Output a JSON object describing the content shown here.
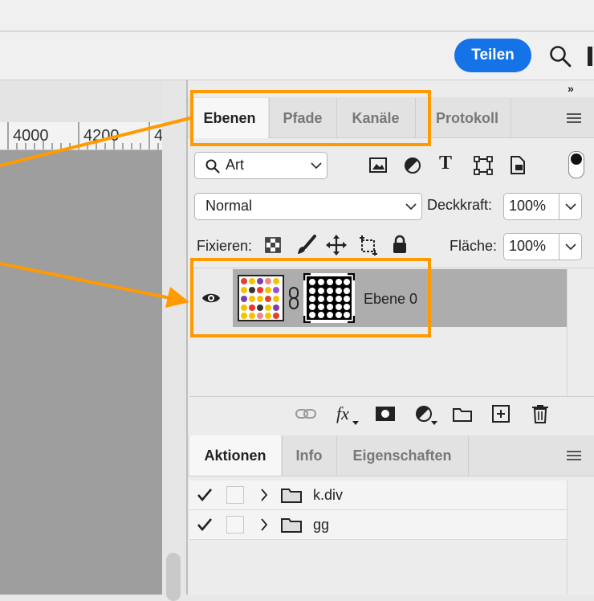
{
  "topbar": {
    "share_label": "Teilen"
  },
  "ruler": {
    "ticks": [
      "4000",
      "4200",
      "4"
    ]
  },
  "panel": {
    "tabs": [
      {
        "label": "Ebenen",
        "active": true
      },
      {
        "label": "Pfade",
        "active": false
      },
      {
        "label": "Kanäle",
        "active": false
      },
      {
        "label": "Protokoll",
        "active": false
      }
    ],
    "filter": {
      "value": "Art"
    },
    "blend_mode": {
      "value": "Normal"
    },
    "opacity": {
      "label": "Deckkraft:",
      "value": "100%"
    },
    "lock": {
      "label": "Fixieren:"
    },
    "fill": {
      "label": "Fläche:",
      "value": "100%"
    },
    "layer": {
      "name": "Ebene 0"
    },
    "bottom_icons": [
      "link-icon",
      "fx-icon",
      "mask-icon",
      "adjustment-icon",
      "folder-icon",
      "new-layer-icon",
      "trash-icon"
    ]
  },
  "actions_panel": {
    "tabs": [
      {
        "label": "Aktionen",
        "active": true
      },
      {
        "label": "Info",
        "active": false
      },
      {
        "label": "Eigenschaften",
        "active": false
      }
    ],
    "items": [
      {
        "name": "k.div",
        "checked": true
      },
      {
        "name": "gg",
        "checked": true
      }
    ]
  },
  "colors": {
    "accent": "#1473e6",
    "highlight": "#ff9a00"
  }
}
